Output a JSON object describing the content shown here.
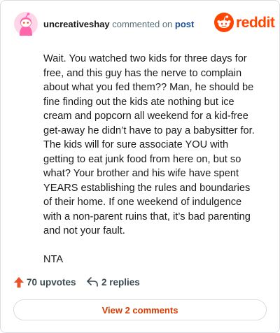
{
  "comment": {
    "username": "uncreativeshay",
    "verb": "commented on",
    "post_link": "post",
    "paragraphs": [
      "Wait. You watched two kids for three days for free, and this guy has the nerve to complain about what you fed them?? Man, he should be fine finding out the kids ate nothing but ice cream and popcorn all weekend for a kid-free get-away he didn’t have to pay a babysitter for. The kids will for sure associate YOU with getting to eat junk food from here on, but so what? Your brother and his wife have spent YEARS establishing the rules and boundaries of their home. If one weekend of indulgence with a non-parent ruins that, it’s bad parenting and not your fault.",
      "NTA"
    ]
  },
  "brand": {
    "name": "reddit",
    "icon": "reddit-snoo-icon",
    "color": "#ff4500"
  },
  "stats": {
    "upvotes_label": "70 upvotes",
    "upvote_icon": "upvote-arrow-icon",
    "upvote_color": "#e8542c",
    "replies_label": "2 replies",
    "reply_icon": "reply-arrow-icon"
  },
  "view_comments_label": "View 2 comments",
  "avatar_icon": "snoo-avatar-icon",
  "colors": {
    "accent": "#d93a00",
    "link": "#1c4f96",
    "avatar_bg": "#ff66ac"
  }
}
